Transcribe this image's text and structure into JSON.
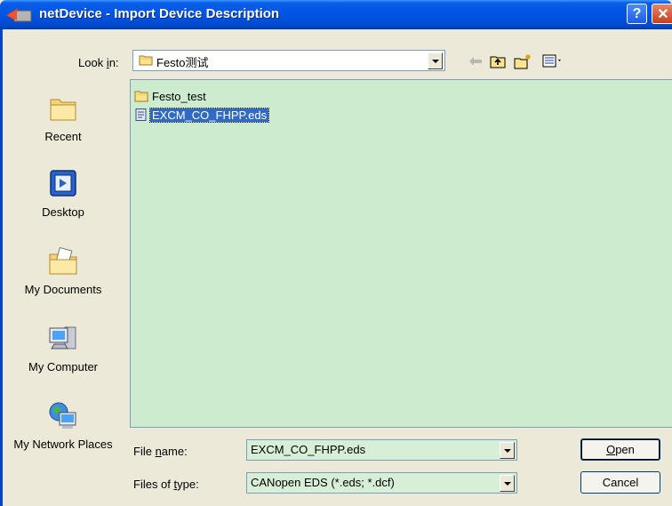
{
  "window": {
    "title": "netDevice - Import Device Description",
    "help_label": "?",
    "close_label": "✕"
  },
  "look_in": {
    "label_pre": "Look ",
    "label_key": "i",
    "label_post": "n:",
    "value": "Festo测试"
  },
  "places": [
    {
      "label": "Recent",
      "icon": "recent-folder-icon"
    },
    {
      "label": "Desktop",
      "icon": "desktop-icon"
    },
    {
      "label": "My Documents",
      "icon": "my-documents-icon"
    },
    {
      "label": "My Computer",
      "icon": "my-computer-icon"
    },
    {
      "label": "My Network Places",
      "icon": "network-places-icon"
    }
  ],
  "files": [
    {
      "name": "Festo_test",
      "type": "folder",
      "selected": false
    },
    {
      "name": "EXCM_CO_FHPP.eds",
      "type": "eds-file",
      "selected": true
    }
  ],
  "file_name": {
    "label_pre": "File ",
    "label_key": "n",
    "label_post": "ame:",
    "value": "EXCM_CO_FHPP.eds"
  },
  "file_type": {
    "label_pre": "Files of ",
    "label_key": "t",
    "label_post": "ype:",
    "value": "CANopen EDS (*.eds; *.dcf)"
  },
  "buttons": {
    "open_key": "O",
    "open_rest": "pen",
    "cancel": "Cancel"
  },
  "colors": {
    "list_background": "#cdeccf",
    "selection": "#316ac5",
    "titlebar": "#0055e5"
  }
}
